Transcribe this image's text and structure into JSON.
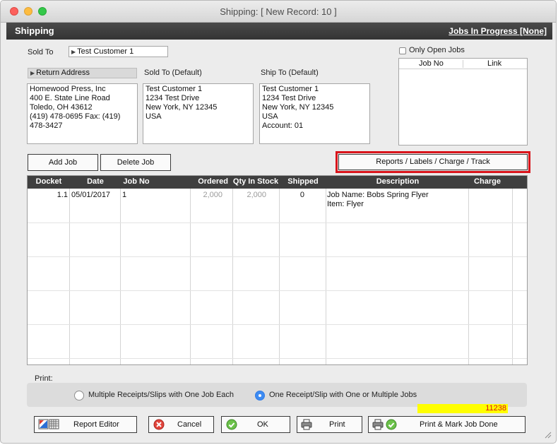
{
  "window": {
    "title": "Shipping:  [ New Record: 10 ]"
  },
  "header": {
    "title": "Shipping",
    "jobs_link": "Jobs In Progress [None]"
  },
  "sold_to": {
    "label": "Sold To",
    "value": "Test Customer 1"
  },
  "only_open_jobs": {
    "label": "Only Open Jobs",
    "checked": false
  },
  "jobs_list": {
    "col_job_no": "Job No",
    "col_link": "Link"
  },
  "return_address": {
    "header": "Return Address",
    "lines": [
      "Homewood Press, Inc",
      "400 E. State Line Road",
      "Toledo, OH  43612",
      "(419) 478-0695   Fax:  (419)",
      "478-3427"
    ]
  },
  "sold_to_default": {
    "label": "Sold To (Default)",
    "lines": [
      "Test Customer 1",
      "1234 Test Drive",
      "New York, NY  12345",
      "USA"
    ]
  },
  "ship_to_default": {
    "label": "Ship To (Default)",
    "lines": [
      "Test Customer 1",
      "1234 Test Drive",
      "New York, NY  12345",
      "USA",
      "Account: 01"
    ]
  },
  "buttons": {
    "add_job": "Add Job",
    "delete_job": "Delete Job",
    "reports": "Reports / Labels / Charge / Track"
  },
  "grid": {
    "columns": [
      "Docket",
      "Date",
      "Job No",
      "Ordered",
      "Qty In Stock",
      "Shipped",
      "Description",
      "Charge"
    ],
    "rows": [
      {
        "docket": "1.1",
        "date": "05/01/2017",
        "job_no": "1",
        "ordered": "2,000",
        "qty_in_stock": "2,000",
        "shipped": "0",
        "description": [
          "Job Name: Bobs Spring Flyer",
          "Item: Flyer"
        ],
        "charge": ""
      }
    ]
  },
  "print": {
    "label": "Print:",
    "option_multiple": "Multiple Receipts/Slips with One Job Each",
    "option_one": "One Receipt/Slip with One or Multiple Jobs",
    "selected": "one"
  },
  "record_number": "11238",
  "footer": {
    "report_editor": "Report Editor",
    "cancel": "Cancel",
    "ok": "OK",
    "print": "Print",
    "print_mark_done": "Print  &  Mark Job Done"
  },
  "colors": {
    "highlight_frame": "#d9141b",
    "selected_radio": "#3d8bf2",
    "record_highlight": "#ffff00"
  }
}
